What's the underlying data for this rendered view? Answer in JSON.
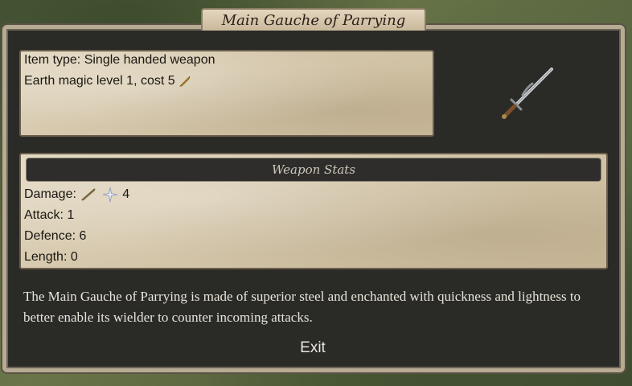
{
  "dialog": {
    "title": "Main Gauche of Parrying"
  },
  "info": {
    "item_type": "Item type: Single handed weapon",
    "magic": "Earth magic level 1, cost 5",
    "magic_icon": "quill-icon"
  },
  "weapon_icon": "sword-icon",
  "stats": {
    "header": "Weapon Stats",
    "damage_label": "Damage:",
    "damage_value": "4",
    "attack": "Attack: 1",
    "defence": "Defence: 6",
    "length": "Length: 0"
  },
  "description": "The Main Gauche of Parrying is made of superior steel and enchanted with quickness and lightness to better enable its wielder to counter incoming attacks.",
  "exit_label": "Exit"
}
